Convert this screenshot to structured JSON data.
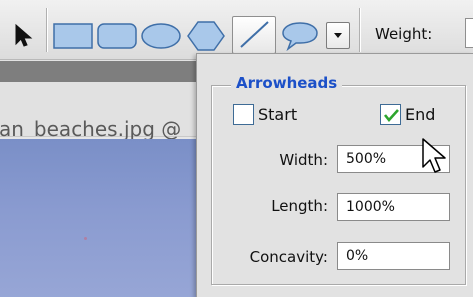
{
  "toolbar": {
    "tools": [
      {
        "name": "arrow-tool",
        "icon": "select-arrow-icon"
      },
      {
        "name": "rectangle-tool",
        "icon": "rectangle-icon"
      },
      {
        "name": "rounded-rectangle-tool",
        "icon": "rounded-rectangle-icon"
      },
      {
        "name": "ellipse-tool",
        "icon": "ellipse-icon"
      },
      {
        "name": "polygon-tool",
        "icon": "polygon-icon"
      },
      {
        "name": "line-tool",
        "icon": "line-icon",
        "selected": true
      },
      {
        "name": "custom-shape-tool",
        "icon": "speech-bubble-icon"
      }
    ],
    "weight_label": "Weight:",
    "weight_value": ""
  },
  "document": {
    "title": "an_beaches.jpg @"
  },
  "arrowheads_panel": {
    "legend": "Arrowheads",
    "start": {
      "label": "Start",
      "checked": false
    },
    "end": {
      "label": "End",
      "checked": true
    },
    "width": {
      "label": "Width:",
      "value": "500%"
    },
    "length": {
      "label": "Length:",
      "value": "1000%"
    },
    "concavity": {
      "label": "Concavity:",
      "value": "0%"
    }
  },
  "colors": {
    "accent": "#1c50c8",
    "shape_fill": "#a9c8ea",
    "check_green": "#2da52d",
    "image_sky": "#8a9bd0"
  }
}
